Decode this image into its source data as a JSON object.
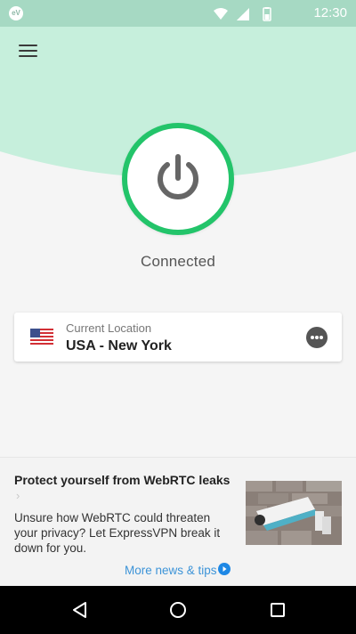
{
  "status_bar": {
    "time": "12:30",
    "app_icon_text": "eV",
    "icons": [
      "wifi-icon",
      "signal-icon",
      "battery-icon"
    ]
  },
  "header": {
    "menu_icon": "hamburger-menu-icon",
    "accent_color": "#c6efdc"
  },
  "connection": {
    "status": "Connected",
    "power_icon": "power-icon",
    "ring_color": "#23c46a"
  },
  "location": {
    "label": "Current Location",
    "value": "USA - New York",
    "flag_icon": "usa-flag-icon",
    "more_icon": "more-options-icon"
  },
  "news": {
    "title": "Protect yourself from WebRTC leaks",
    "chevron": "›",
    "body": "Unsure how WebRTC could threaten your privacy? Let ExpressVPN break it down for you.",
    "link": "More news & tips",
    "link_color": "#3d94d8",
    "image_icon": "security-camera-illustration"
  },
  "nav": {
    "buttons": [
      "back-icon",
      "home-icon",
      "recents-icon"
    ]
  }
}
